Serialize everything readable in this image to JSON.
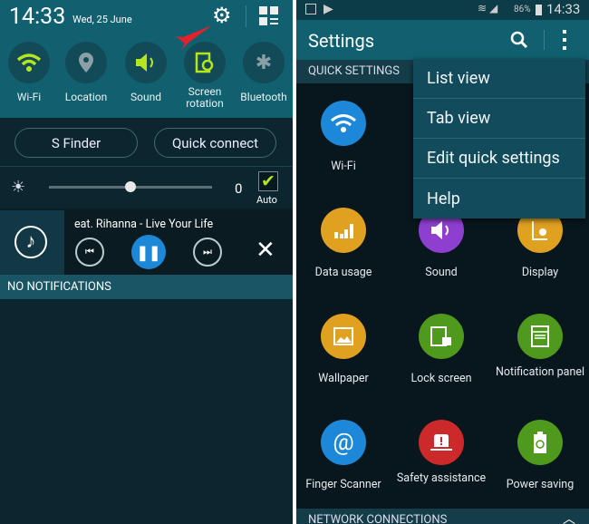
{
  "left": {
    "time": "14:33",
    "date": "Wed, 25 June",
    "toggles": [
      {
        "label": "Wi-Fi",
        "icon": "wifi-icon",
        "on": true
      },
      {
        "label": "Location",
        "icon": "location-icon",
        "on": false
      },
      {
        "label": "Sound",
        "icon": "sound-icon",
        "on": true
      },
      {
        "label": "Screen rotation",
        "icon": "screen-rotation-icon",
        "on": true
      },
      {
        "label": "Bluetooth",
        "icon": "bluetooth-icon",
        "on": false
      }
    ],
    "s_finder": "S Finder",
    "quick_connect": "Quick connect",
    "brightness": {
      "value": "0",
      "level": 0.5,
      "auto_label": "Auto",
      "auto_checked": true
    },
    "music": {
      "track": "eat. Rihanna - Live Your Life"
    },
    "no_notifications": "NO NOTIFICATIONS"
  },
  "right": {
    "status": {
      "battery": "86%",
      "time": "14:33"
    },
    "title": "Settings",
    "section": "QUICK SETTINGS",
    "menu": [
      "List view",
      "Tab view",
      "Edit quick settings",
      "Help"
    ],
    "grid": [
      {
        "label": "Wi-Fi",
        "color": "#1e88d8"
      },
      {
        "label": "Data usage",
        "color": "#e0a020"
      },
      {
        "label": "Sound",
        "color": "#8e3fcf"
      },
      {
        "label": "Display",
        "color": "#e0a020"
      },
      {
        "label": "Wallpaper",
        "color": "#e0a020"
      },
      {
        "label": "Lock screen",
        "color": "#4f9a1c"
      },
      {
        "label": "Notification panel",
        "color": "#4f9a1c"
      },
      {
        "label": "Finger Scanner",
        "color": "#1e88d8"
      },
      {
        "label": "Safety assistance",
        "color": "#cc2a2a"
      },
      {
        "label": "Power saving",
        "color": "#4f9a1c"
      }
    ],
    "footer": "NETWORK CONNECTIONS"
  },
  "colors": {
    "accent_green": "#b5e61d",
    "teal": "#115e6e",
    "play_blue": "#1e88d8"
  }
}
